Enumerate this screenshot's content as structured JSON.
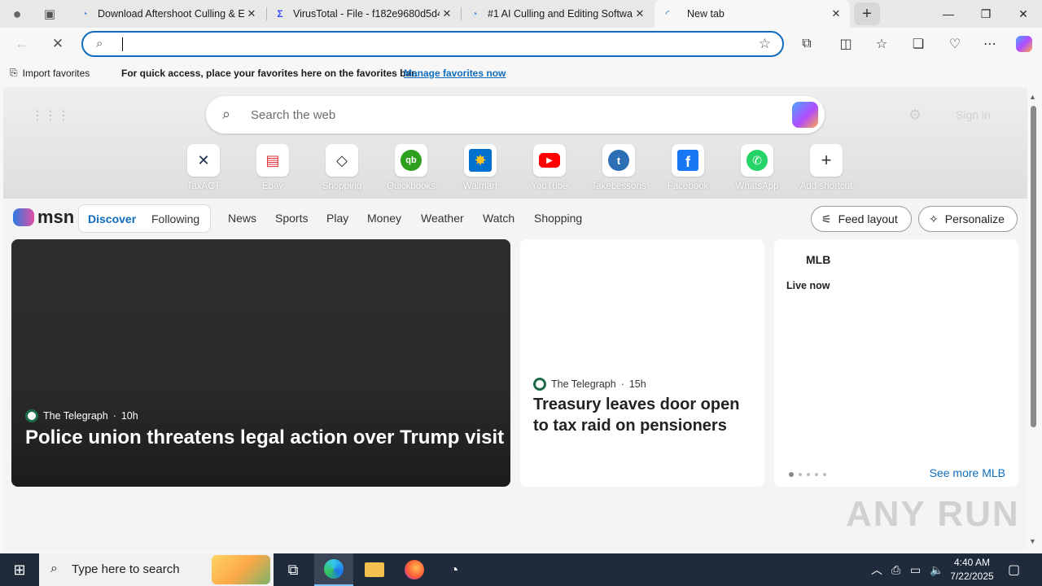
{
  "browser": {
    "tabs": [
      {
        "title": "Download Aftershoot Culling & E",
        "icon": "aftershoot-icon"
      },
      {
        "title": "VirusTotal - File - f182e9680d5d4",
        "icon": "virustotal-icon"
      },
      {
        "title": "#1 AI Culling and Editing Softwar",
        "icon": "aftershoot-icon"
      },
      {
        "title": "New tab",
        "icon": "loading-icon"
      }
    ],
    "address_value": "",
    "favorites_bar": {
      "import_label": "Import favorites",
      "message": "For quick access, place your favorites here on the favorites bar.",
      "manage_link": "Manage favorites now"
    }
  },
  "newtab": {
    "search_placeholder": "Search the web",
    "signin_label": "Sign in",
    "shortcuts": [
      {
        "label": "TaxACT",
        "glyph": "✕",
        "color": "#1c2a4a"
      },
      {
        "label": "Ebay",
        "glyph": "🛍",
        "color": "#e53238"
      },
      {
        "label": "Shopping",
        "glyph": "🏷",
        "color": "#333333"
      },
      {
        "label": "Quickbooks",
        "glyph": "qb",
        "color": "#2ca01c"
      },
      {
        "label": "Walmart",
        "glyph": "✸",
        "color": "#0071ce"
      },
      {
        "label": "YouTube",
        "glyph": "▶",
        "color": "#ff0000"
      },
      {
        "label": "TakeLessons",
        "glyph": "t",
        "color": "#2d6fb5"
      },
      {
        "label": "Facebook",
        "glyph": "f",
        "color": "#1877f2"
      },
      {
        "label": "WhatsApp",
        "glyph": "✆",
        "color": "#25d366"
      },
      {
        "label": "Add shortcut",
        "glyph": "+",
        "color": "#333333"
      }
    ]
  },
  "msn": {
    "logo_text": "msn",
    "segments": [
      "Discover",
      "Following"
    ],
    "nav": [
      "News",
      "Sports",
      "Play",
      "Money",
      "Weather",
      "Watch",
      "Shopping"
    ],
    "feed_layout_label": "Feed layout",
    "personalize_label": "Personalize",
    "hero_card": {
      "source": "The Telegraph",
      "age": "10h",
      "headline": "Police union threatens legal action over Trump visit"
    },
    "mid_card": {
      "source": "The Telegraph",
      "age": "15h",
      "headline": "Treasury leaves door open to tax raid on pensioners"
    },
    "mlb_card": {
      "title": "MLB",
      "live_label": "Live now",
      "see_more": "See more MLB"
    }
  },
  "watermark": "ANY RUN",
  "taskbar": {
    "search_placeholder": "Type here to search",
    "time": "4:40 AM",
    "date": "7/22/2025"
  },
  "colors": {
    "accent": "#0f6cbd",
    "taskbar": "#1f2a3a"
  }
}
